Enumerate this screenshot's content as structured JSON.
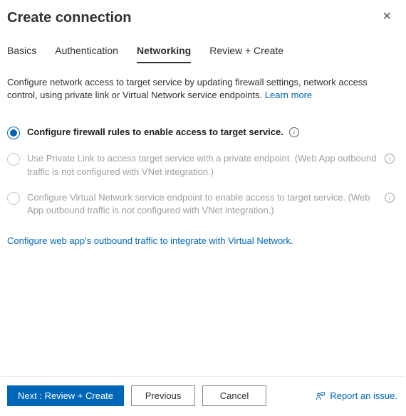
{
  "header": {
    "title": "Create connection"
  },
  "tabs": {
    "basics": "Basics",
    "authentication": "Authentication",
    "networking": "Networking",
    "review_create": "Review + Create"
  },
  "networking": {
    "description": "Configure network access to target service by updating firewall settings, network access control, using private link or Virtual Network service endpoints. ",
    "learn_more": "Learn more",
    "options": {
      "firewall": "Configure firewall rules to enable access to target service.",
      "private_link": "Use Private Link to access target service with a private endpoint. (Web App outbound traffic is not configured with VNet integration.)",
      "vnet_endpoint": "Configure Virtual Network service endpoint to enable access to target service. (Web App outbound traffic is not configured with VNet integration.)"
    },
    "configure_outbound": "Configure web app's outbound traffic to integrate with Virtual Network."
  },
  "footer": {
    "next": "Next : Review + Create",
    "previous": "Previous",
    "cancel": "Cancel",
    "report": "Report an issue."
  }
}
